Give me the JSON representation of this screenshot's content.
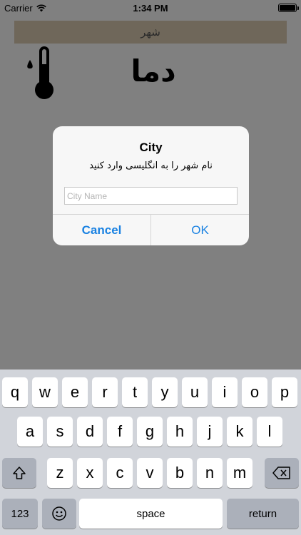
{
  "status_bar": {
    "carrier": "Carrier",
    "time": "1:34 PM"
  },
  "app": {
    "city_bar": "شهر",
    "title": "دما"
  },
  "alert": {
    "title": "City",
    "message": "نام شهر را به انگلیسی وارد کنید",
    "input_placeholder": "City Name",
    "input_value": "",
    "cancel": "Cancel",
    "ok": "OK"
  },
  "keyboard": {
    "row1": [
      "q",
      "w",
      "e",
      "r",
      "t",
      "y",
      "u",
      "i",
      "o",
      "p"
    ],
    "row2": [
      "a",
      "s",
      "d",
      "f",
      "g",
      "h",
      "j",
      "k",
      "l"
    ],
    "row3": [
      "z",
      "x",
      "c",
      "v",
      "b",
      "n",
      "m"
    ],
    "numbers": "123",
    "space": "space",
    "return": "return"
  },
  "colors": {
    "accent": "#1a82e2",
    "overlay": "#808080",
    "keyboard_bg": "#d1d4da"
  }
}
